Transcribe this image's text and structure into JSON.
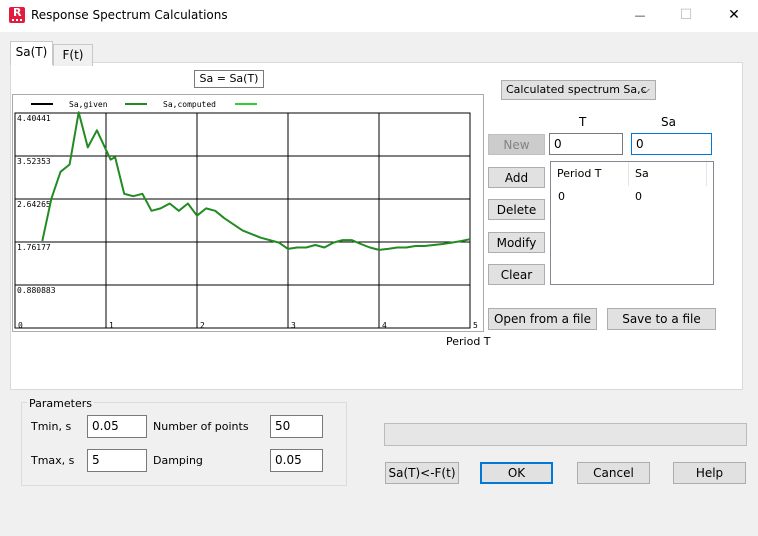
{
  "window": {
    "title": "Response Spectrum Calculations",
    "icon_letter": "R",
    "minimize_glyph": "—",
    "maximize_glyph": "☐",
    "close_glyph": "✕"
  },
  "tabs": [
    {
      "label": "Sa(T)",
      "active": true
    },
    {
      "label": "F(t)",
      "active": false
    }
  ],
  "chart_title": "Sa = Sa(T)",
  "xlabel": "Period T",
  "chart_data": {
    "type": "line",
    "legend": [
      "Sa,given",
      "Sa,computed",
      ""
    ],
    "legend_colors": [
      "#000000",
      "#228b22",
      "#32cd32"
    ],
    "x_ticks": [
      "0",
      "1",
      "2",
      "3",
      "4",
      "5"
    ],
    "y_ticks": [
      "0",
      "0.880883",
      "1.76177",
      "2.64265",
      "3.52353",
      "4.40441"
    ],
    "xlim": [
      0,
      5
    ],
    "ylim": [
      0,
      4.40441
    ],
    "grid": true,
    "series": [
      {
        "name": "Sa,computed",
        "color": "#228b22",
        "x": [
          0.3,
          0.4,
          0.5,
          0.6,
          0.7,
          0.8,
          0.9,
          1.0,
          1.05,
          1.1,
          1.2,
          1.3,
          1.4,
          1.5,
          1.6,
          1.7,
          1.8,
          1.9,
          2.0,
          2.1,
          2.2,
          2.3,
          2.5,
          2.7,
          2.9,
          3.0,
          3.1,
          3.2,
          3.3,
          3.4,
          3.5,
          3.6,
          3.7,
          3.8,
          3.9,
          4.0,
          4.1,
          4.2,
          4.3,
          4.4,
          4.5,
          4.6,
          4.7,
          4.8,
          4.9,
          5.0
        ],
        "y": [
          1.78,
          2.65,
          3.2,
          3.35,
          4.42,
          3.7,
          4.05,
          3.65,
          3.45,
          3.5,
          2.75,
          2.7,
          2.75,
          2.4,
          2.45,
          2.55,
          2.4,
          2.55,
          2.3,
          2.45,
          2.4,
          2.25,
          2.0,
          1.85,
          1.75,
          1.62,
          1.65,
          1.65,
          1.7,
          1.65,
          1.75,
          1.8,
          1.8,
          1.72,
          1.65,
          1.6,
          1.62,
          1.65,
          1.65,
          1.68,
          1.68,
          1.7,
          1.72,
          1.75,
          1.78,
          1.82
        ]
      }
    ]
  },
  "spectrum_select": {
    "value": "Calculated spectrum Sa,c",
    "chevron": "⌵"
  },
  "col_T_label": "T",
  "col_Sa_label": "Sa",
  "t_input_value": "0",
  "sa_input_value": "0",
  "buttons": {
    "new": "New",
    "add": "Add",
    "delete": "Delete",
    "modify": "Modify",
    "clear": "Clear",
    "open_file": "Open from a file",
    "save_file": "Save to a file",
    "sat_from_ft": "Sa(T)<-F(t)",
    "ok": "OK",
    "cancel": "Cancel",
    "help": "Help"
  },
  "table": {
    "headers": [
      "Period T",
      "Sa"
    ],
    "rows": [
      [
        "0",
        "0"
      ]
    ]
  },
  "parameters": {
    "legend": "Parameters",
    "tmin_label": "Tmin, s",
    "tmin_value": "0.05",
    "tmax_label": "Tmax, s",
    "tmax_value": "5",
    "npoints_label": "Number of points",
    "npoints_value": "50",
    "damping_label": "Damping",
    "damping_value": "0.05"
  },
  "progress": 0
}
